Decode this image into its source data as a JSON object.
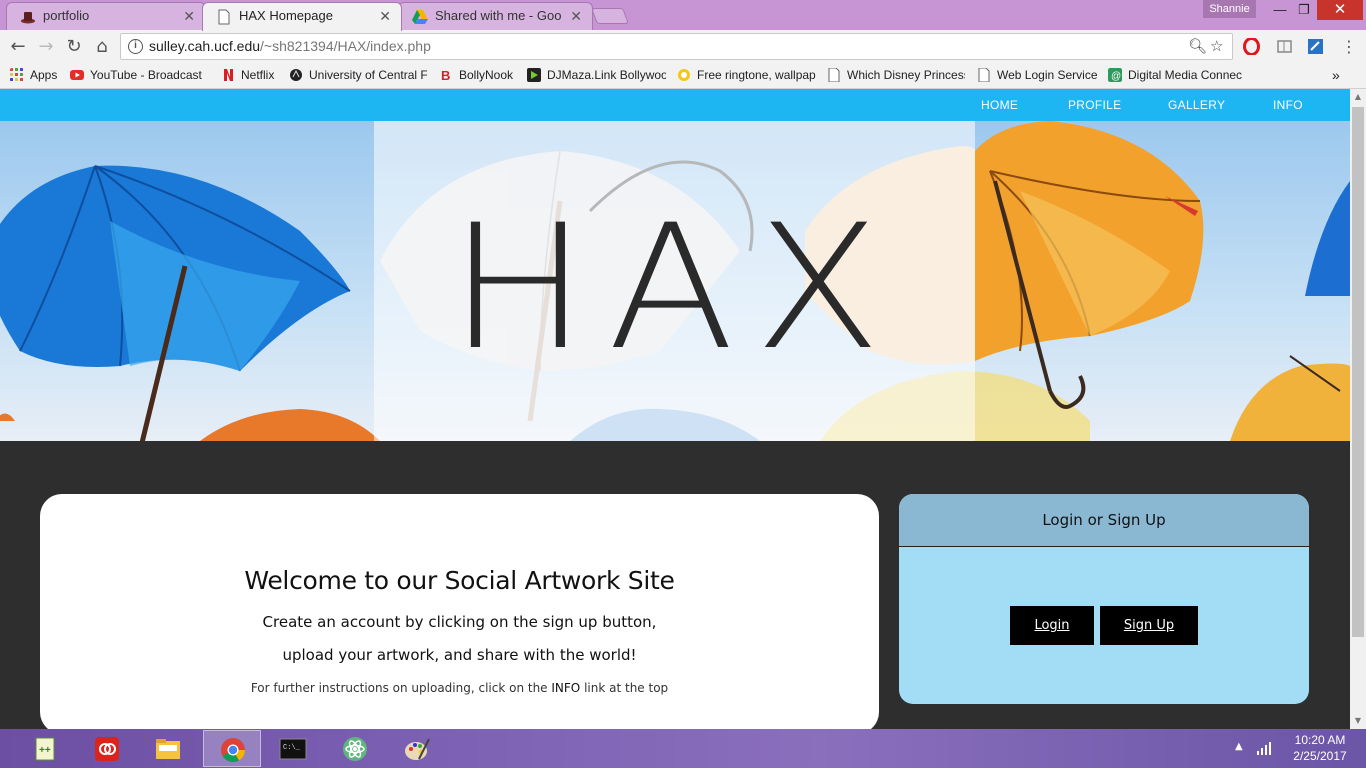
{
  "tabs": [
    {
      "title": "portfolio",
      "icon": "hat-icon"
    },
    {
      "title": "HAX Homepage",
      "icon": "page-icon"
    },
    {
      "title": "Shared with me - Google",
      "icon": "drive-icon"
    }
  ],
  "window": {
    "profile_name": "Shannie",
    "minimize": "—",
    "restore": "❐",
    "close": "✕"
  },
  "toolbar": {
    "back": "←",
    "forward": "→",
    "reload": "↻",
    "home": "⌂"
  },
  "address": {
    "host": "sulley.cah.ucf.edu",
    "path": "/~sh821394/HAX/index.php"
  },
  "bookmarks": [
    {
      "label": "Apps",
      "icon": "apps-grid-icon"
    },
    {
      "label": "YouTube - Broadcast",
      "icon": "youtube-icon"
    },
    {
      "label": "Netflix",
      "icon": "netflix-icon"
    },
    {
      "label": "University of Central F",
      "icon": "ucf-icon"
    },
    {
      "label": "BollyNook",
      "icon": "bollynook-icon"
    },
    {
      "label": "DJMaza.Link Bollywoo",
      "icon": "djmaza-icon"
    },
    {
      "label": "Free ringtone, wallpap",
      "icon": "ringtone-icon"
    },
    {
      "label": "Which Disney Princess",
      "icon": "page-icon"
    },
    {
      "label": "Web Login Service",
      "icon": "page-icon"
    },
    {
      "label": "Digital Media Connec",
      "icon": "digital-media-icon"
    }
  ],
  "bookmarks_overflow": "»",
  "site": {
    "nav": [
      "HOME",
      "PROFILE",
      "GALLERY",
      "INFO"
    ],
    "hero_title": "HAX",
    "welcome": {
      "title": "Welcome to our Social Artwork Site",
      "line1": "Create an account by clicking on the sign up button,",
      "line2": "upload your artwork, and share with the world!",
      "note_prefix": "For further instructions on uploading, click on the ",
      "note_link": "INFO",
      "note_suffix": " link at the top"
    },
    "auth": {
      "heading": "Login or Sign Up",
      "login": "Login",
      "signup": "Sign Up"
    }
  },
  "taskbar": {
    "apps": [
      "notepad-plus-icon",
      "adobe-cc-icon",
      "file-explorer-icon",
      "chrome-icon",
      "terminal-icon",
      "atom-icon",
      "paint-icon"
    ],
    "time": "10:20 AM",
    "date": "2/25/2017"
  },
  "colors": {
    "nav_bar": "#1eb5f3",
    "login_panel": "#a3dcf5",
    "login_header": "#8ab8d3",
    "page_bg": "#2e2e2e"
  }
}
